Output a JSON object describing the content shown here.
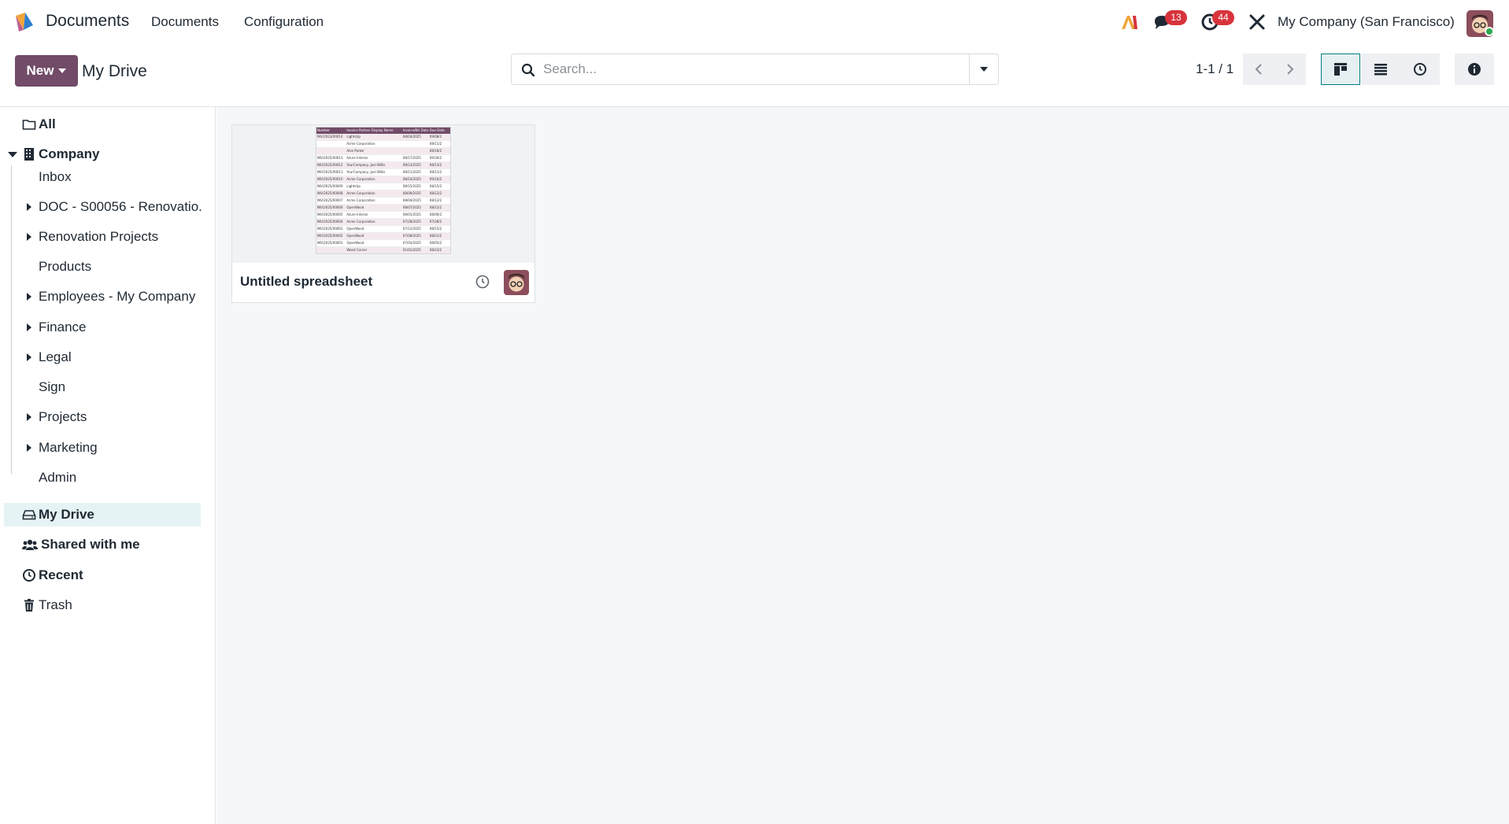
{
  "topnav": {
    "app_name": "Documents",
    "menu": [
      "Documents",
      "Configuration"
    ],
    "ai_icon": "ai-icon",
    "messages_badge": "13",
    "activities_badge": "44",
    "company": "My Company (San Francisco)"
  },
  "control": {
    "new_label": "New",
    "breadcrumb": "My Drive",
    "search_placeholder": "Search...",
    "pager": "1-1 / 1"
  },
  "sidebar": {
    "all": "All",
    "company": "Company",
    "company_children": [
      {
        "label": "Inbox",
        "expandable": false
      },
      {
        "label": "DOC - S00056 - Renovatio.",
        "expandable": true
      },
      {
        "label": "Renovation Projects",
        "expandable": true
      },
      {
        "label": "Products",
        "expandable": false
      },
      {
        "label": "Employees - My Company",
        "expandable": true
      },
      {
        "label": "Finance",
        "expandable": true
      },
      {
        "label": "Legal",
        "expandable": true
      },
      {
        "label": "Sign",
        "expandable": false
      },
      {
        "label": "Projects",
        "expandable": true
      },
      {
        "label": "Marketing",
        "expandable": true
      },
      {
        "label": "Admin",
        "expandable": false
      }
    ],
    "my_drive": "My Drive",
    "shared": "Shared with me",
    "recent": "Recent",
    "trash": "Trash"
  },
  "documents": [
    {
      "title": "Untitled spreadsheet",
      "thumbnail_headers": [
        "Number",
        "Invoice Partner Display Name",
        "Invoice/Bill Date",
        "Due Date"
      ],
      "thumbnail_rows": [
        [
          "INV/2023/00014",
          "LightsUp",
          "08/04/2025",
          "09/08/2"
        ],
        [
          "",
          "Acme Corporation",
          "",
          "08/11/2"
        ],
        [
          "",
          "Alex Parker",
          "",
          "08/18/2"
        ],
        [
          "INV/2025/00013",
          "Azure Interior",
          "08/17/2025",
          "09/30/2"
        ],
        [
          "INV/2025/00012",
          "YourCompany, Joel Willis",
          "08/13/2025",
          "08/13/2"
        ],
        [
          "INV/2025/00011",
          "YourCompany, Joel Willis",
          "08/11/2025",
          "08/11/2"
        ],
        [
          "INV/2025/00010",
          "Acme Corporation",
          "08/10/2025",
          "09/10/2"
        ],
        [
          "INV/2025/00009",
          "LightsUp",
          "08/15/2025",
          "08/15/2"
        ],
        [
          "INV/2025/00008",
          "Acme Corporation",
          "08/09/2025",
          "08/12/2"
        ],
        [
          "INV/2025/00007",
          "Acme Corporation",
          "08/04/2025",
          "08/12/2"
        ],
        [
          "INV/2025/00006",
          "OpenWood",
          "08/07/2025",
          "08/11/2"
        ],
        [
          "INV/2025/00005",
          "Azure Interior",
          "08/01/2025",
          "08/06/2"
        ],
        [
          "INV/2025/00004",
          "Acme Corporation",
          "07/28/2025",
          "07/28/2"
        ],
        [
          "INV/2025/00003",
          "OpenWood",
          "07/12/2025",
          "08/15/2"
        ],
        [
          "INV/2025/00002",
          "OpenWood",
          "07/08/2025",
          "08/21/2"
        ],
        [
          "INV/2025/00001",
          "OpenWood",
          "07/03/2025",
          "08/05/2"
        ],
        [
          "",
          "Wood Corner",
          "01/01/2025",
          "08/23/2"
        ]
      ]
    }
  ],
  "colors": {
    "brand": "#714b67",
    "badge": "#d8333c",
    "selected_bg": "#e6f3f4",
    "active_view_border": "#017e84",
    "online": "#2fa84f"
  }
}
